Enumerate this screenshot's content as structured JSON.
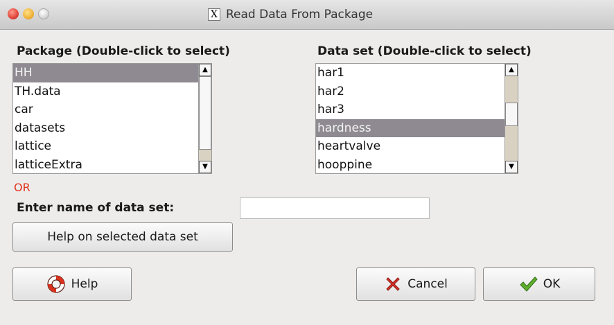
{
  "window": {
    "title": "Read Data From Package",
    "title_icon_glyph": "X"
  },
  "package_list": {
    "label": "Package (Double-click to select)",
    "items": [
      "HH",
      "TH.data",
      "car",
      "datasets",
      "lattice",
      "latticeExtra"
    ],
    "selected": "HH"
  },
  "dataset_list": {
    "label": "Data set (Double-click to select)",
    "items": [
      "har1",
      "har2",
      "har3",
      "hardness",
      "heartvalve",
      "hooppine"
    ],
    "selected": "hardness"
  },
  "or_label": "OR",
  "name_entry": {
    "label": "Enter name of data set:",
    "value": ""
  },
  "buttons": {
    "help_dataset": "Help on selected data set",
    "help": "Help",
    "cancel": "Cancel",
    "ok": "OK"
  },
  "colors": {
    "selection": "#8f8a92",
    "or_text": "#e0341c",
    "scrollbar_trough": "#d9d2c3",
    "window_bg": "#edeceb"
  }
}
